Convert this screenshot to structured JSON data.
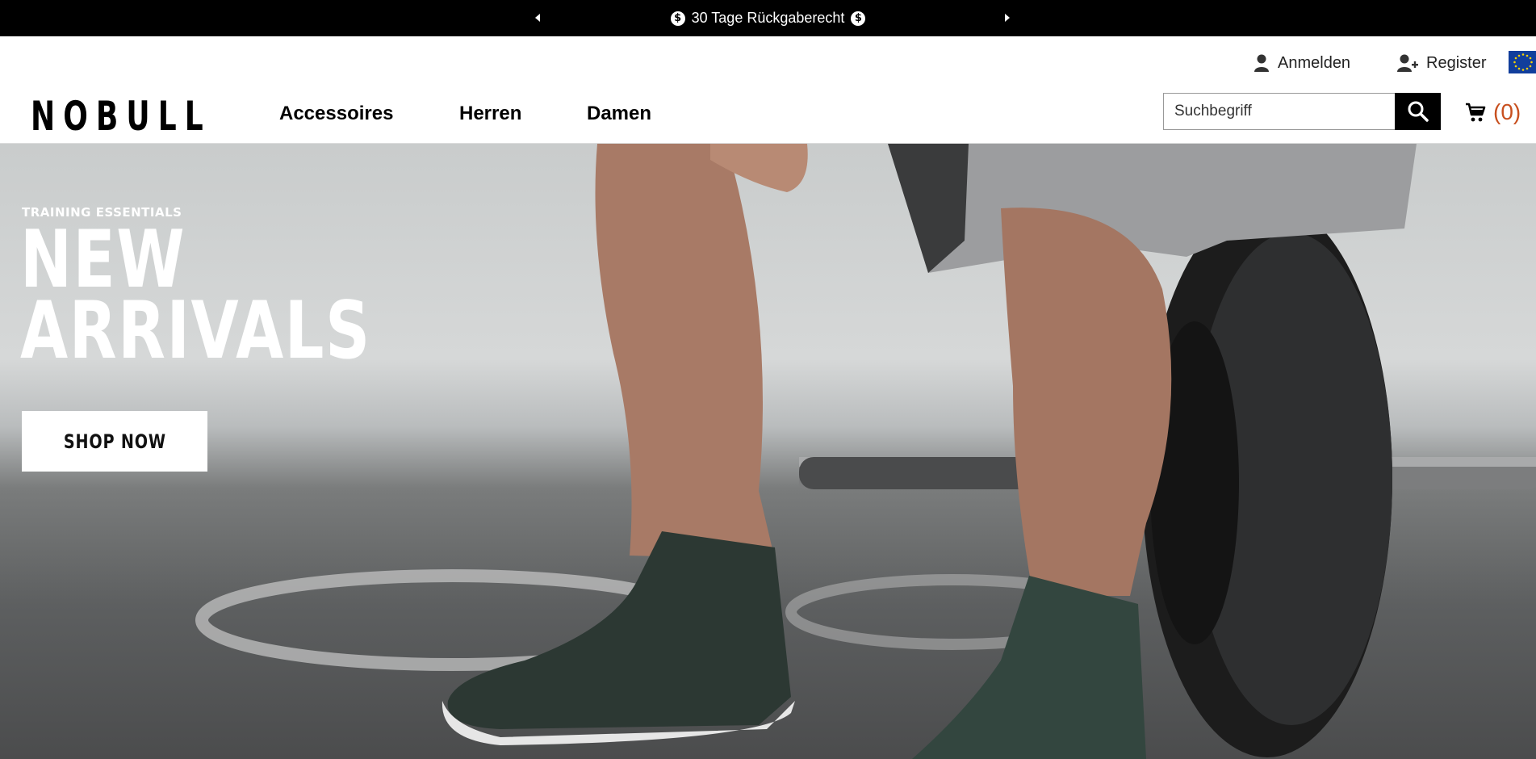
{
  "announcement": {
    "text": "30 Tage Rückgaberecht",
    "prev_icon": "caret-left-icon",
    "next_icon": "caret-right-icon",
    "badge_icon": "dollar-circle-icon"
  },
  "header": {
    "login_label": "Anmelden",
    "register_label": "Register",
    "region_flag": "eu-flag-icon",
    "logo_text": "NOBULL",
    "nav": [
      {
        "label": "Accessoires"
      },
      {
        "label": "Herren"
      },
      {
        "label": "Damen"
      }
    ],
    "search": {
      "placeholder": "Suchbegriff"
    },
    "cart_count": "(0)"
  },
  "hero": {
    "eyebrow": "TRAINING ESSENTIALS",
    "headline_line1": "NEW",
    "headline_line2": "ARRIVALS",
    "cta_label": "SHOP NOW"
  },
  "colors": {
    "accent": "#c8501f",
    "bar": "#000000",
    "flag": "#113e9c"
  }
}
